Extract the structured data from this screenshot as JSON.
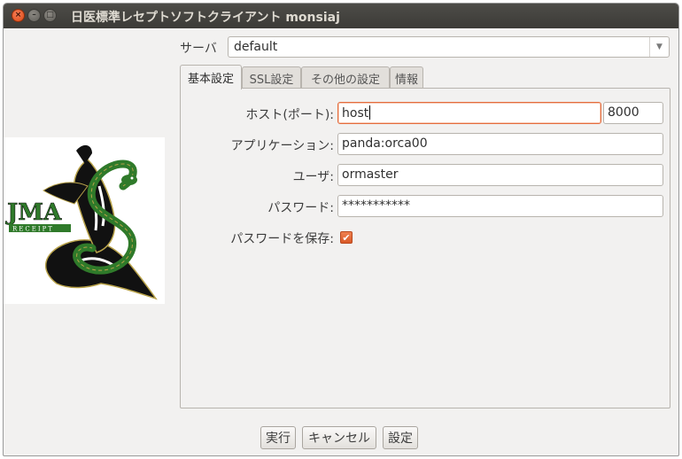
{
  "window": {
    "title": "日医標準レセプトソフトクライアント monsiaj",
    "close_glyph": "×",
    "min_glyph": "–",
    "max_glyph": "□"
  },
  "logo": {
    "brand_text": "JMA",
    "sub_text": "RECEIPT",
    "colors": {
      "snake": "#2f7a2a",
      "dark": "#111111",
      "gold": "#b8a24a"
    }
  },
  "server": {
    "label": "サーバ",
    "value": "default",
    "arrow_icon": "chevron-down-icon"
  },
  "tabs": [
    {
      "label": "基本設定",
      "active": true
    },
    {
      "label": "SSL設定",
      "active": false
    },
    {
      "label": "その他の設定",
      "active": false
    },
    {
      "label": "情報",
      "active": false
    }
  ],
  "form": {
    "host_label": "ホスト(ポート):",
    "host_value": "host",
    "port_value": "8000",
    "app_label": "アプリケーション:",
    "app_value": "panda:orca00",
    "user_label": "ユーザ:",
    "user_value": "ormaster",
    "password_label": "パスワード:",
    "password_value": "***********",
    "save_password_label": "パスワードを保存:",
    "save_password_checked": true,
    "check_glyph": "✔"
  },
  "buttons": {
    "run": "実行",
    "cancel": "キャンセル",
    "settings": "設定"
  },
  "colors": {
    "accent": "#dd4814",
    "titlebar": "#3c3b37",
    "background": "#f2f1f0"
  }
}
